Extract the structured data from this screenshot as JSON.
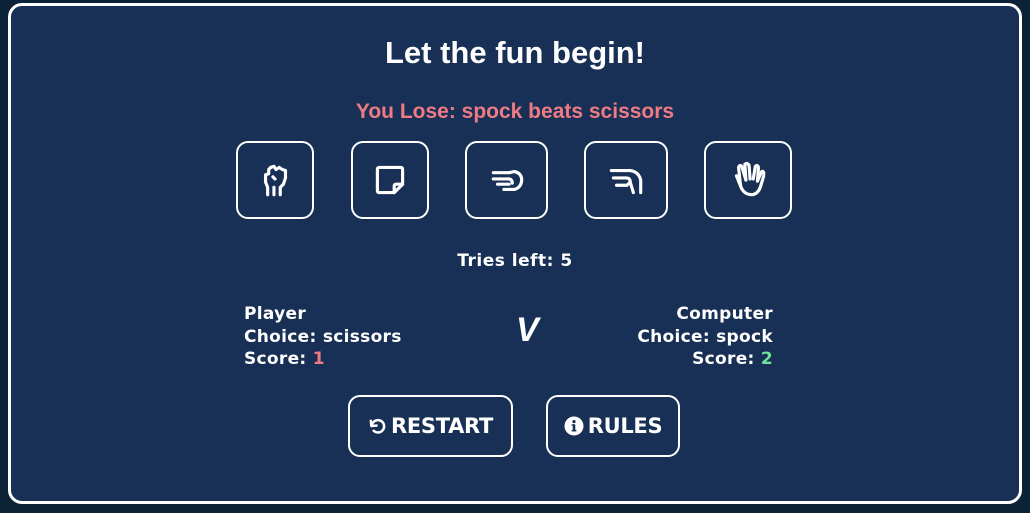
{
  "title": "Let the fun begin!",
  "result": {
    "message": "You Lose: spock beats scissors",
    "color": "#ef7b85"
  },
  "choices": [
    {
      "name": "rock",
      "icon": "hand-rock-icon"
    },
    {
      "name": "paper",
      "icon": "hand-paper-icon"
    },
    {
      "name": "scissors",
      "icon": "hand-scissors-icon"
    },
    {
      "name": "lizard",
      "icon": "hand-lizard-icon"
    },
    {
      "name": "spock",
      "icon": "hand-spock-icon"
    }
  ],
  "tries": {
    "label": "Tries left:",
    "value": "5"
  },
  "player": {
    "heading": "Player",
    "choice_label": "Choice:",
    "choice": "scissors",
    "score_label": "Score:",
    "score": "1",
    "score_color": "#ef7b85"
  },
  "versus": "V",
  "computer": {
    "heading": "Computer",
    "choice_label": "Choice:",
    "choice": "spock",
    "score_label": "Score:",
    "score": "2",
    "score_color": "#6ee39a"
  },
  "buttons": {
    "restart_label": "RESTART",
    "restart_icon": "undo-icon",
    "rules_label": "RULES",
    "rules_icon": "info-circle-icon"
  },
  "colors": {
    "background": "#183055",
    "page_background": "#0c2236",
    "border": "#ffffff",
    "text": "#ffffff"
  }
}
